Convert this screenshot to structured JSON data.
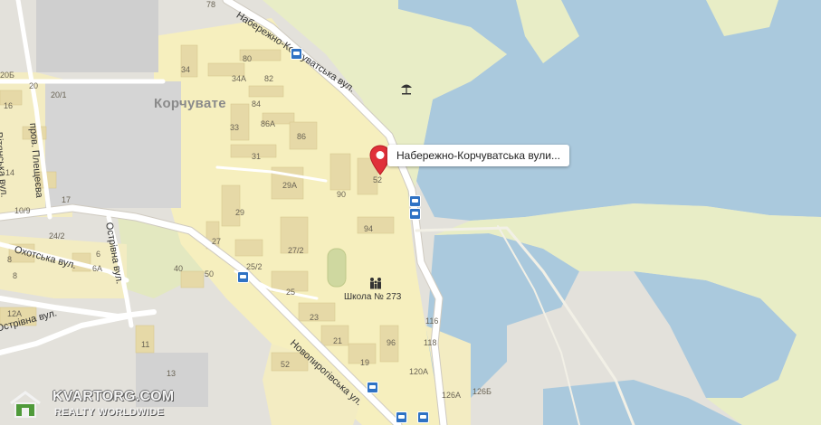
{
  "map": {
    "district": "Корчувате",
    "popup_text": "Набережно-Корчуватська вули...",
    "streets": {
      "naberezhno": "Набережно-Корчуватська вул.",
      "naberezhno_short": "Набережно-Корчуватська вул.",
      "novopyrohivska": "Новопирогівська ул.",
      "ostrivna": "Острівна вул.",
      "ostrivna_lower": "Острівна вул.",
      "okhotska": "Охотська вул.",
      "pletseva": "пров. Плещеєва",
      "vitianska": "Вітянська вул."
    },
    "school": "Школа № 273",
    "house_numbers": {
      "n78": "78",
      "n80": "80",
      "n34": "34",
      "n34a": "34А",
      "n82": "82",
      "n84": "84",
      "n86a": "86А",
      "n33": "33",
      "n86": "86",
      "n31": "31",
      "n29a": "29А",
      "n90": "90",
      "n52": "52",
      "n29": "29",
      "n94": "94",
      "n27": "27",
      "n27_2": "27/2",
      "n25_2": "25/2",
      "n40": "40",
      "n50": "50",
      "n25": "25",
      "n23": "23",
      "n21": "21",
      "n19": "19",
      "n96": "96",
      "n116": "116",
      "n118": "118",
      "n120a": "120А",
      "n126a": "126А",
      "n126b": "126Б",
      "n52b": "52",
      "n13": "13",
      "n11": "11",
      "n12a": "12А",
      "n6a": "6А",
      "n6": "6",
      "n8": "8",
      "n24_2": "24/2",
      "n10_9": "10/9",
      "n17": "17",
      "n20_1": "20/1",
      "n20": "20",
      "n20b": "20Б",
      "n16": "16",
      "n14": "14",
      "n8b": "8"
    }
  },
  "watermark": {
    "title": "KVARTORG.COM",
    "subtitle": "REALTY WORLDWIDE"
  },
  "colors": {
    "water": "#aac9dd",
    "park": "#e8edc6",
    "residential": "#f6efbe",
    "industrial": "#d8d8d8",
    "road": "#ffffff",
    "building": "#e9ddb0",
    "pin": "#e0303a",
    "bus_stop": "#2f72c4"
  }
}
